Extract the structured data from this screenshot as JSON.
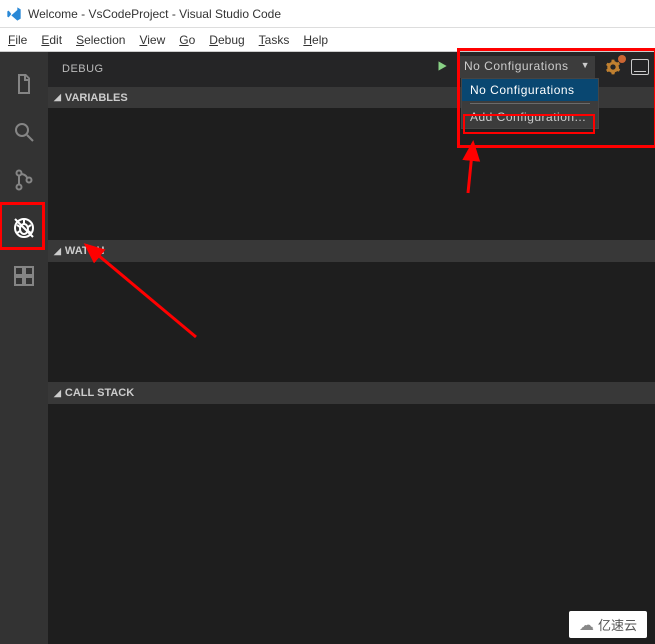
{
  "window": {
    "title": "Welcome - VsCodeProject - Visual Studio Code"
  },
  "menubar": {
    "items": [
      {
        "key": "F",
        "rest": "ile"
      },
      {
        "key": "E",
        "rest": "dit"
      },
      {
        "key": "S",
        "rest": "election"
      },
      {
        "key": "V",
        "rest": "iew"
      },
      {
        "key": "G",
        "rest": "o"
      },
      {
        "key": "D",
        "rest": "ebug"
      },
      {
        "key": "T",
        "rest": "asks"
      },
      {
        "key": "H",
        "rest": "elp"
      }
    ]
  },
  "activitybar": {
    "items": [
      {
        "name": "explorer-icon"
      },
      {
        "name": "search-icon"
      },
      {
        "name": "source-control-icon"
      },
      {
        "name": "debug-icon",
        "active": true
      },
      {
        "name": "extensions-icon"
      }
    ]
  },
  "sidebar": {
    "title": "DEBUG",
    "config_selected": "No Configurations",
    "dropdown": {
      "items": [
        "No Configurations",
        "Add Configuration..."
      ]
    },
    "sections": [
      {
        "label": "VARIABLES",
        "body_height": 132
      },
      {
        "label": "WATCH",
        "body_height": 120
      },
      {
        "label": "CALL STACK",
        "body_height": 240
      }
    ]
  },
  "watermark": {
    "text": "亿速云"
  }
}
